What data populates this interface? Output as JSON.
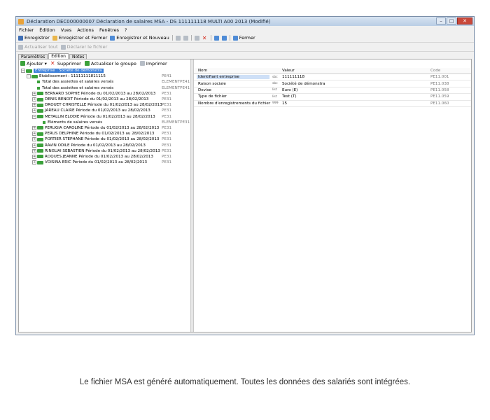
{
  "window": {
    "title": "Déclaration DEC000000007 Déclaration de salaires MSA - DS 111111118 MULTI A00 2013 (Modifié)"
  },
  "menu": [
    "Fichier",
    "Édition",
    "Vues",
    "Actions",
    "Fenêtres",
    "?"
  ],
  "toolbar1": {
    "save": "Enregistrer",
    "save_close": "Enregistrer et Fermer",
    "save_new": "Enregistrer et Nouveau",
    "close": "Fermer"
  },
  "toolbar2": {
    "refresh_all": "Actualiser tout",
    "declare_file": "Déclarer le fichier"
  },
  "tabs": [
    "Paramètres",
    "Edition",
    "Notes"
  ],
  "tree_toolbar": {
    "add": "Ajouter",
    "delete": "Supprimer",
    "refresh_group": "Actualiser le groupe",
    "print": "Imprimer"
  },
  "tree": [
    {
      "label": "Entreprise : Société de démonstra",
      "code": "",
      "level": 0,
      "selected": true,
      "type": "node"
    },
    {
      "label": "Etablissement : 11111111811115",
      "code": "PE41",
      "level": 1,
      "type": "node"
    },
    {
      "label": "Total des assiettes et salaires versés",
      "code": "ELEMENTPE41",
      "level": 2,
      "type": "leaf"
    },
    {
      "label": "Total des assiettes et salaires versés",
      "code": "ELEMENTPE41",
      "level": 2,
      "type": "leaf"
    },
    {
      "label": "BERNARD SOPHIE Période du 01/02/2013 au 28/02/2013",
      "code": "PE31",
      "level": 2,
      "type": "node"
    },
    {
      "label": "DENIS BENOIT Période du 01/02/2013 au 28/02/2013",
      "code": "PE31",
      "level": 2,
      "type": "node"
    },
    {
      "label": "DROUET CHRISTELLE Période du 01/02/2013 au 28/02/2013",
      "code": "PE31",
      "level": 2,
      "type": "node"
    },
    {
      "label": "JAREAU CLAIRE Période du 01/02/2013 au 28/02/2013",
      "code": "PE31",
      "level": 2,
      "type": "node"
    },
    {
      "label": "METALLIN ELODIE Période du 01/02/2013 au 28/02/2013",
      "code": "PE31",
      "level": 2,
      "type": "node"
    },
    {
      "label": "Eléments de salaires versés",
      "code": "ELEMENTPE31",
      "level": 3,
      "type": "leaf"
    },
    {
      "label": "PERUGIA CAROLINE Période du 01/02/2013 au 28/02/2013",
      "code": "PE31",
      "level": 2,
      "type": "node"
    },
    {
      "label": "PERUS DELPHINE Période du 01/02/2013 au 28/02/2013",
      "code": "PE31",
      "level": 2,
      "type": "node"
    },
    {
      "label": "PORTIER STEPHANE Période du 01/02/2013 au 28/02/2013",
      "code": "PE31",
      "level": 2,
      "type": "node"
    },
    {
      "label": "RAVIN ODILE Période du 01/02/2013 au 28/02/2013",
      "code": "PE31",
      "level": 2,
      "type": "node"
    },
    {
      "label": "RINGUAI SEBASTIEN Période du 01/02/2013 au 28/02/2013",
      "code": "PE31",
      "level": 2,
      "type": "node"
    },
    {
      "label": "ROQUES JEANNE Période du 01/02/2013 au 28/02/2013",
      "code": "PE31",
      "level": 2,
      "type": "node"
    },
    {
      "label": "VOISINA ERIC Période du 01/02/2013 au 28/02/2013",
      "code": "PE31",
      "level": 2,
      "type": "node"
    }
  ],
  "grid": {
    "headers": {
      "name": "Nom",
      "value": "Valeur",
      "code": "Code"
    },
    "rows": [
      {
        "name": "Identifiant entreprise",
        "type": "sbc",
        "value": "111111118",
        "code": "PE11.001",
        "selected": true
      },
      {
        "name": "Raison sociale",
        "type": "sbc",
        "value": "Société de démonstra",
        "code": "PE11.038"
      },
      {
        "name": "Devise",
        "type": "list",
        "value": "Euro (E)",
        "code": "PE11.058"
      },
      {
        "name": "Type de fichier",
        "type": "list",
        "value": "Test (T)",
        "code": "PE11.059"
      },
      {
        "name": "Nombre d'enregistrements du fichier",
        "type": "999",
        "value": "15",
        "code": "PE11.060"
      }
    ]
  },
  "caption": "Le fichier MSA est généré automatiquement. Toutes les données des salariés sont intégrées."
}
